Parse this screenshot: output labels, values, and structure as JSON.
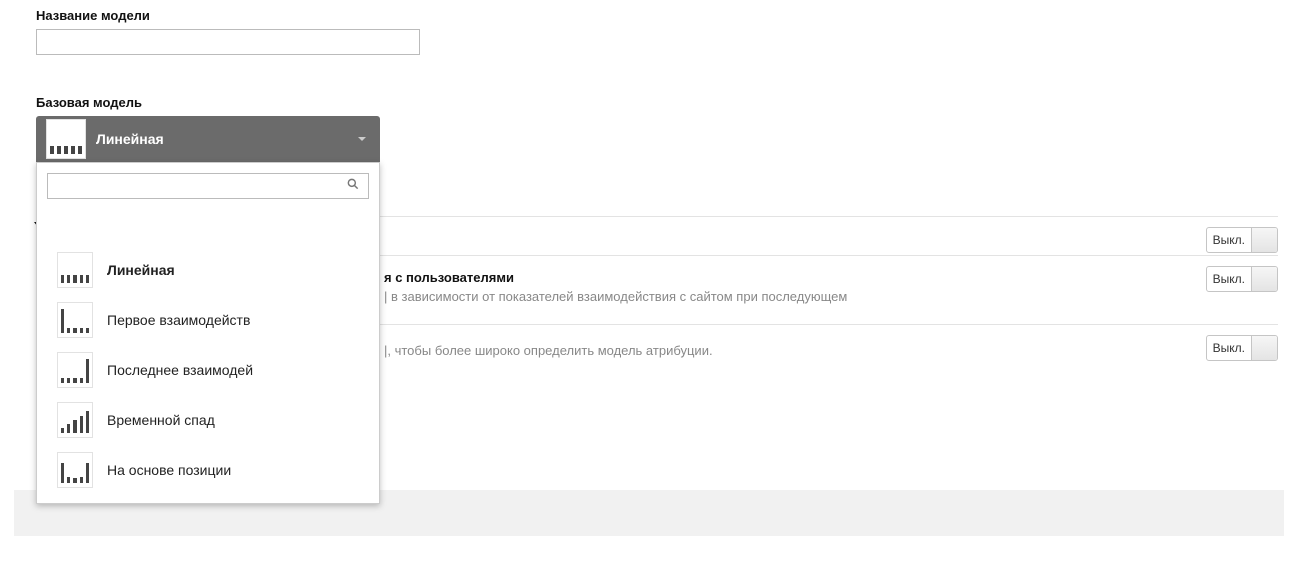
{
  "form": {
    "name_label": "Название модели",
    "name_value": "",
    "base_label": "Базовая модель"
  },
  "dropdown": {
    "selected_label": "Линейная",
    "search_value": "",
    "options": [
      {
        "label": "Линейная"
      },
      {
        "label": "Первое взаимодейств"
      },
      {
        "label": "Последнее взаимодей"
      },
      {
        "label": "Временной спад"
      },
      {
        "label": "На основе позиции"
      }
    ]
  },
  "sections": [
    {
      "title_fragment": "",
      "desc_fragment": "",
      "toggle_label": "Выкл."
    },
    {
      "title_fragment": "я с пользователями",
      "desc_fragment": "| в зависимости от показателей взаимодействия с сайтом при последующем",
      "toggle_label": "Выкл."
    },
    {
      "title_fragment": "",
      "desc_fragment": "|, чтобы более широко определить модель атрибуции.",
      "toggle_label": "Выкл."
    }
  ]
}
